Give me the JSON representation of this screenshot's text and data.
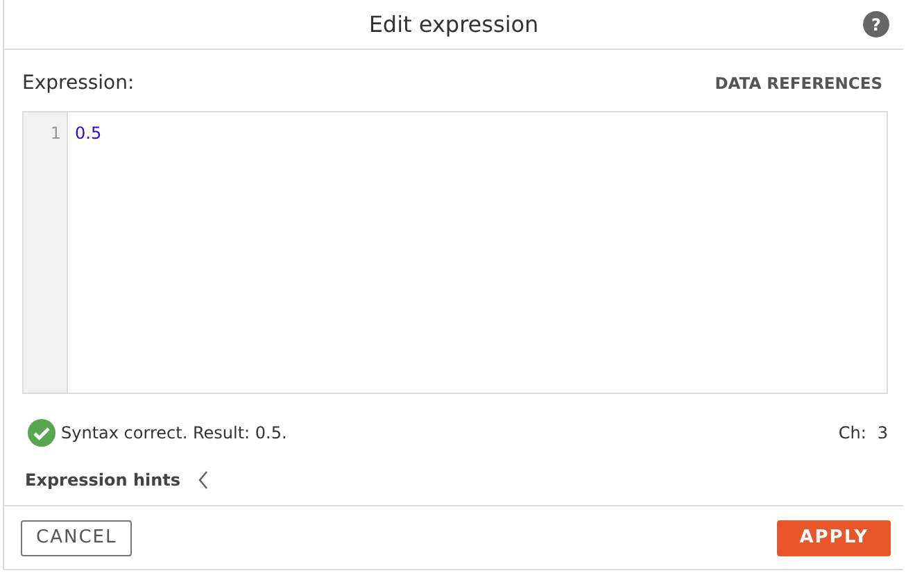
{
  "dialog": {
    "title": "Edit expression",
    "help": "?"
  },
  "expression_label": "Expression:",
  "data_references_link": "DATA REFERENCES",
  "editor": {
    "lines": [
      {
        "number": "1",
        "code": "0.5"
      }
    ]
  },
  "status": {
    "kind": "valid",
    "message": "Syntax correct. Result: 0.5.",
    "char_count_label": "Ch:",
    "char_count": "3"
  },
  "hints": {
    "label": "Expression hints",
    "expanded": false
  },
  "buttons": [
    {
      "label": "CANCEL",
      "kind": "secondary"
    },
    {
      "label": "APPLY",
      "kind": "primary"
    }
  ]
}
